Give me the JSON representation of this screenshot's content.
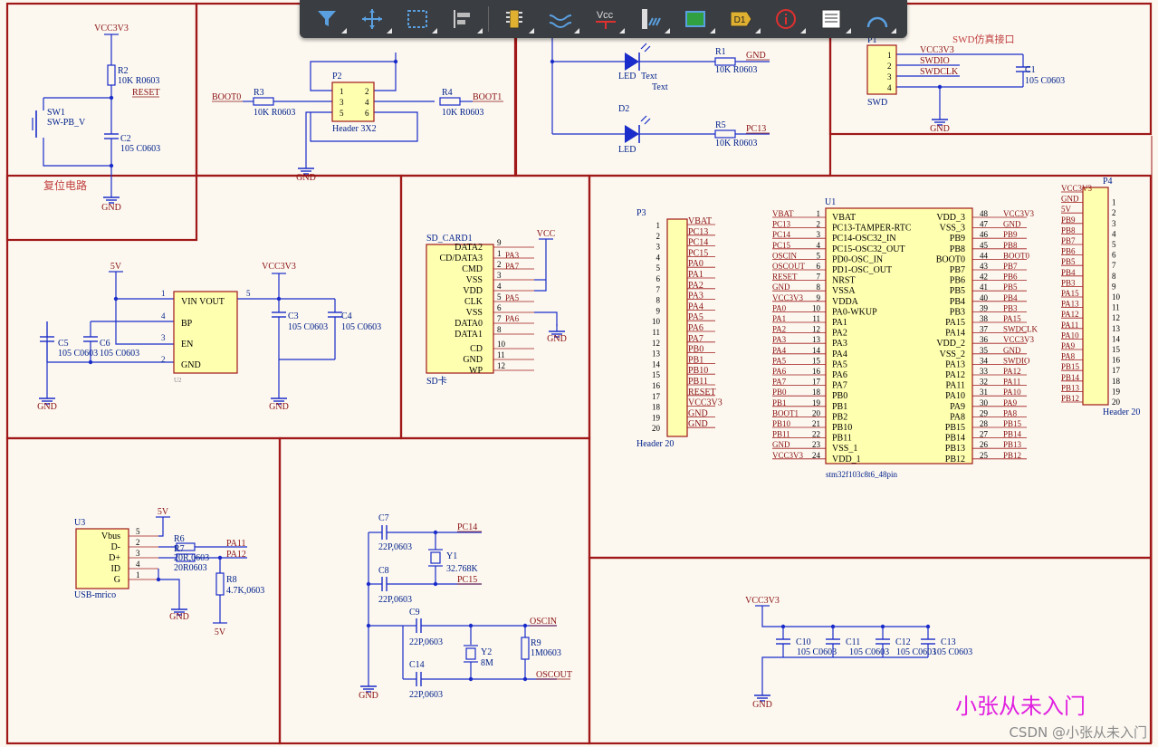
{
  "toolbar": {
    "tools": [
      "filter-tool",
      "move-tool",
      "select-tool",
      "align-tool",
      "component-tool",
      "wire-tool",
      "power-port-tool",
      "bus-tool",
      "harness-tool",
      "net-label-tool",
      "info-tool",
      "text-frame-tool",
      "arc-tool"
    ],
    "power_label": "Vcc",
    "netlabel_glyph": "D1"
  },
  "colors": {
    "sheet_bg": "#fcf8f0",
    "wire": "#1a2cc9",
    "frame": "#a01818",
    "net": "#8a1010",
    "part_fill": "#ffffb0"
  },
  "reset": {
    "vcc": "VCC3V3",
    "r2": "R2",
    "r2_val": "10K R0603",
    "net": "RESET",
    "sw": "SW1",
    "sw_val": "SW-PB_V",
    "c2": "C2",
    "c2_val": "105 C0603",
    "title": "复位电路",
    "gnd": "GND"
  },
  "boot": {
    "boot0": "BOOT0",
    "boot1": "BOOT1",
    "r3": "R3",
    "r3_val": "10K R0603",
    "r4": "R4",
    "r4_val": "10K R0603",
    "p2": "P2",
    "p2_val": "Header 3X2",
    "pins": [
      "1",
      "2",
      "3",
      "4",
      "5",
      "6"
    ],
    "gnd": "GND"
  },
  "leds": {
    "d1_val": "LED",
    "d1_text": "Text",
    "d1_text2": "Text",
    "r1": "R1",
    "r1_val": "10K R0603",
    "gnd": "GND",
    "d2": "D2",
    "d2_val": "LED",
    "r5": "R5",
    "r5_val": "10K R0603",
    "pc13": "PC13"
  },
  "swd": {
    "title": "SWD仿真接口",
    "p1": "P1",
    "pins": [
      "1",
      "2",
      "3",
      "4"
    ],
    "vcc": "VCC3V3",
    "swdio": "SWDIO",
    "swdclk": "SWDCLK",
    "c1": "C1",
    "c1_val": "105 C0603",
    "name": "SWD",
    "gnd": "GND"
  },
  "ldo": {
    "v5": "5V",
    "vcc": "VCC3V3",
    "vin_vout": "VIN  VOUT",
    "bp": "BP",
    "en": "EN",
    "gnd_pin": "GND",
    "pins": [
      "1",
      "4",
      "3",
      "2",
      "5"
    ],
    "u2": "U2",
    "c3": "C3",
    "c3_val": "105 C0603",
    "c4": "C4",
    "c4_val": "105 C0603",
    "c5": "C5",
    "c5_val": "105 C0603",
    "c6": "C6",
    "c6_val": "105 C0603",
    "gnd": "GND"
  },
  "sd": {
    "title": "SD_CARD1",
    "pins": [
      "DATA2",
      "CD/DATA3",
      "CMD",
      "VSS",
      "VDD",
      "CLK",
      "VSS",
      "DATA0",
      "DATA1",
      "CD",
      "GND",
      "WP"
    ],
    "nums": [
      "9",
      "1",
      "2",
      "3",
      "4",
      "5",
      "6",
      "7",
      "8",
      "10",
      "11",
      "12"
    ],
    "nets": [
      "PA3",
      "PA7",
      "PA5",
      "PA6"
    ],
    "vcc": "VCC",
    "gnd": "GND",
    "label": "SD卡"
  },
  "p3": {
    "name": "P3",
    "value": "Header 20",
    "nets": [
      "VBAT",
      "PC13",
      "PC14",
      "PC15",
      "PA0",
      "PA1",
      "PA2",
      "PA3",
      "PA4",
      "PA5",
      "PA6",
      "PA7",
      "PB0",
      "PB1",
      "PB10",
      "PB11",
      "RESET",
      "VCC3V3",
      "GND",
      "GND"
    ]
  },
  "u1": {
    "name": "U1",
    "value": "stm32f103c8t6_48pin",
    "left_pins": [
      "VBAT",
      "PC13-TAMPER-RTC",
      "PC14-OSC32_IN",
      "PC15-OSC32_OUT",
      "PD0-OSC_IN",
      "PD1-OSC_OUT",
      "NRST",
      "VSSA",
      "VDDA",
      "PA0-WKUP",
      "PA1",
      "PA2",
      "PA3",
      "PA4",
      "PA5",
      "PA6",
      "PA7",
      "PB0",
      "PB1",
      "PB2",
      "PB10",
      "PB11",
      "VSS_1",
      "VDD_1"
    ],
    "left_nets": [
      "VBAT",
      "PC13",
      "PC14",
      "PC15",
      "OSCIN",
      "OSCOUT",
      "RESET",
      "GND",
      "VCC3V3",
      "PA0",
      "PA1",
      "PA2",
      "PA3",
      "PA4",
      "PA5",
      "PA6",
      "PA7",
      "PB0",
      "PB1",
      "BOOT1",
      "PB10",
      "PB11",
      "GND",
      "VCC3V3"
    ],
    "left_nums": [
      "1",
      "2",
      "3",
      "4",
      "5",
      "6",
      "7",
      "8",
      "9",
      "10",
      "11",
      "12",
      "13",
      "14",
      "15",
      "16",
      "17",
      "18",
      "19",
      "20",
      "21",
      "22",
      "23",
      "24"
    ],
    "right_pins": [
      "VDD_3",
      "VSS_3",
      "PB9",
      "PB8",
      "BOOT0",
      "PB7",
      "PB6",
      "PB5",
      "PB4",
      "PB3",
      "PA15",
      "PA14",
      "VDD_2",
      "VSS_2",
      "PA13",
      "PA12",
      "PA11",
      "PA10",
      "PA9",
      "PA8",
      "PB15",
      "PB14",
      "PB13",
      "PB12"
    ],
    "right_nets": [
      "VCC3V3",
      "GND",
      "PB9",
      "PB8",
      "BOOT0",
      "PB7",
      "PB6",
      "PB5",
      "PB4",
      "PB3",
      "PA15",
      "SWDCLK",
      "VCC3V3",
      "GND",
      "SWDIO",
      "PA12",
      "PA11",
      "PA10",
      "PA9",
      "PA8",
      "PB15",
      "PB14",
      "PB13",
      "PB12"
    ],
    "right_nums": [
      "48",
      "47",
      "46",
      "45",
      "44",
      "43",
      "42",
      "41",
      "40",
      "39",
      "38",
      "37",
      "36",
      "35",
      "34",
      "33",
      "32",
      "31",
      "30",
      "29",
      "28",
      "27",
      "26",
      "25"
    ]
  },
  "p4": {
    "name": "P4",
    "value": "Header 20",
    "nets": [
      "VCC3V3",
      "GND",
      "5V",
      "PB9",
      "PB8",
      "PB7",
      "PB6",
      "PB5",
      "PB4",
      "PB3",
      "PA15",
      "PA13",
      "PA12",
      "PA11",
      "PA10",
      "PA9",
      "PA8",
      "PB15",
      "PB14",
      "PB13",
      "PB12"
    ]
  },
  "usb": {
    "name": "U3",
    "value": "USB-mrico",
    "pins": [
      "Vbus",
      "D-",
      "D+",
      "ID",
      "G"
    ],
    "nums": [
      "5",
      "2",
      "3",
      "4",
      "1"
    ],
    "v5": "5V",
    "r6": "R6",
    "r7": "R7",
    "r6_val": "20R,0603",
    "r7_val": "20R0603",
    "pa11": "PA11",
    "pa12": "PA12",
    "r8": "R8",
    "r8_val": "4.7K,0603",
    "v5b": "5V",
    "gnd": "GND"
  },
  "osc": {
    "c7": "C7",
    "c7_val": "22P,0603",
    "pc14": "PC14",
    "y1": "Y1",
    "y1_val": "32.768K",
    "c8": "C8",
    "c8_val": "22P,0603",
    "pc15": "PC15",
    "c9": "C9",
    "c9_val": "22P,0603",
    "oscin": "OSCIN",
    "r9": "R9",
    "r9_val": "1M0603",
    "y2": "Y2",
    "y2_val": "8M",
    "c14": "C14",
    "c14_val": "22P,0603",
    "oscout": "OSCOUT",
    "gnd": "GND"
  },
  "decoupling": {
    "vcc": "VCC3V3",
    "caps": [
      "C10",
      "C11",
      "C12",
      "C13"
    ],
    "value": "105 C0603",
    "gnd": "GND"
  },
  "watermark": "小张从未入门",
  "csdn": "CSDN @小张从未入门"
}
